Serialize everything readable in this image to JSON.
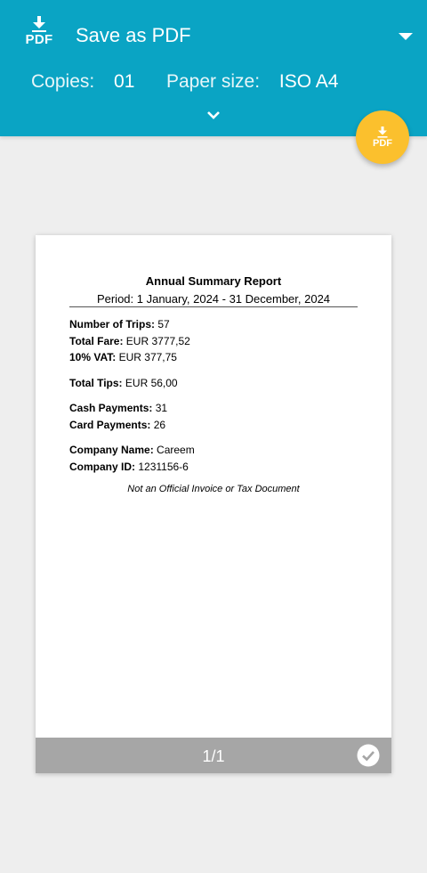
{
  "header": {
    "logo_text": "PDF",
    "destination": "Save as PDF",
    "copies_label": "Copies:",
    "copies_value": "01",
    "paper_label": "Paper size:",
    "paper_value": "ISO A4",
    "accent_color": "#0aa4c4"
  },
  "fab": {
    "text": "PDF",
    "color": "#fbc02d"
  },
  "document": {
    "title": "Annual Summary Report",
    "period": "Period: 1 January, 2024 - 31 December, 2024",
    "trips_label": "Number of Trips:",
    "trips_value": "57",
    "fare_label": "Total Fare:",
    "fare_value": "EUR 3777,52",
    "vat_label": "10% VAT:",
    "vat_value": "EUR 377,75",
    "tips_label": "Total Tips:",
    "tips_value": "EUR 56,00",
    "cash_label": "Cash Payments:",
    "cash_value": "31",
    "card_label": "Card Payments:",
    "card_value": "26",
    "company_name_label": "Company Name:",
    "company_name_value": "Careem",
    "company_id_label": "Company ID:",
    "company_id_value": "1231156-6",
    "note": "Not an Official Invoice or Tax Document"
  },
  "preview": {
    "page_indicator": "1/1"
  }
}
